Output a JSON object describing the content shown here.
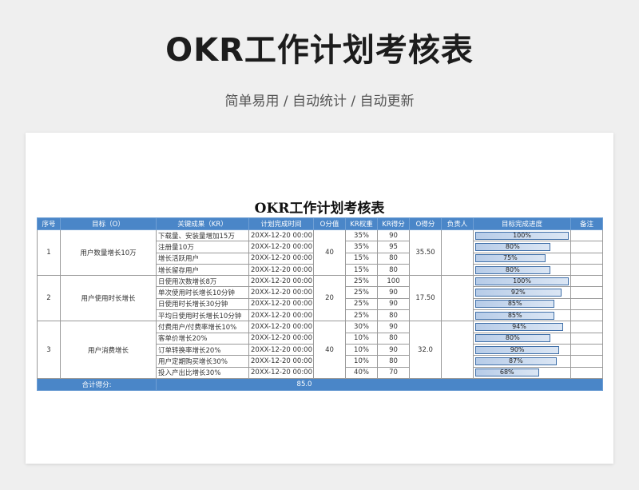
{
  "hero": {
    "title": "OKR工作计划考核表",
    "subtitle": "简单易用 / 自动统计 / 自动更新"
  },
  "sheet": {
    "title": "OKR工作计划考核表",
    "columns": [
      "序号",
      "目标（O）",
      "关键成果（KR）",
      "计划完成时间",
      "O分值",
      "KR权重",
      "KR得分",
      "O得分",
      "负责人",
      "目标完成进度",
      "备注"
    ],
    "objectives": [
      {
        "no": "1",
        "objective": "用户数量增长10万",
        "o_value": "40",
        "o_score": "35.50",
        "krs": [
          {
            "kr": "下载量、安装量增加15万",
            "date": "20XX-12-20 00:00:00",
            "weight": "35%",
            "score": "90",
            "progress": 1.0,
            "progress_label": "100%"
          },
          {
            "kr": "注册量10万",
            "date": "20XX-12-20 00:00:00",
            "weight": "35%",
            "score": "95",
            "progress": 0.8,
            "progress_label": "80%"
          },
          {
            "kr": "增长活跃用户",
            "date": "20XX-12-20 00:00:00",
            "weight": "15%",
            "score": "80",
            "progress": 0.75,
            "progress_label": "75%"
          },
          {
            "kr": "增长留存用户",
            "date": "20XX-12-20 00:00:00",
            "weight": "15%",
            "score": "80",
            "progress": 0.8,
            "progress_label": "80%"
          }
        ]
      },
      {
        "no": "2",
        "objective": "用户使用时长增长",
        "o_value": "20",
        "o_score": "17.50",
        "krs": [
          {
            "kr": "日使用次数增长8万",
            "date": "20XX-12-20 00:00:00",
            "weight": "25%",
            "score": "100",
            "progress": 1.0,
            "progress_label": "100%"
          },
          {
            "kr": "单次使用时长增长10分钟",
            "date": "20XX-12-20 00:00:00",
            "weight": "25%",
            "score": "90",
            "progress": 0.92,
            "progress_label": "92%"
          },
          {
            "kr": "日使用时长增长30分钟",
            "date": "20XX-12-20 00:00:00",
            "weight": "25%",
            "score": "90",
            "progress": 0.85,
            "progress_label": "85%"
          },
          {
            "kr": "平均日使用时长增长10分钟",
            "date": "20XX-12-20 00:00:00",
            "weight": "25%",
            "score": "80",
            "progress": 0.85,
            "progress_label": "85%"
          }
        ]
      },
      {
        "no": "3",
        "objective": "用户消费增长",
        "o_value": "40",
        "o_score": "32.0",
        "krs": [
          {
            "kr": "付费用户/付费率增长10%",
            "date": "20XX-12-20 00:00:00",
            "weight": "30%",
            "score": "90",
            "progress": 0.94,
            "progress_label": "94%"
          },
          {
            "kr": "客单价增长20%",
            "date": "20XX-12-20 00:00:00",
            "weight": "10%",
            "score": "80",
            "progress": 0.8,
            "progress_label": "80%"
          },
          {
            "kr": "订单转换率增长20%",
            "date": "20XX-12-20 00:00:00",
            "weight": "10%",
            "score": "90",
            "progress": 0.9,
            "progress_label": "90%"
          },
          {
            "kr": "用户定期购买增长30%",
            "date": "20XX-12-20 00:00:00",
            "weight": "10%",
            "score": "80",
            "progress": 0.87,
            "progress_label": "87%"
          },
          {
            "kr": "投入产出比增长30%",
            "date": "20XX-12-20 00:00:00",
            "weight": "40%",
            "score": "70",
            "progress": 0.68,
            "progress_label": "68%"
          }
        ]
      }
    ],
    "total": {
      "label": "合计得分:",
      "value": "85.0"
    }
  },
  "colors": {
    "header_bg": "#4a86c8",
    "bar_border": "#3f6fa8"
  }
}
